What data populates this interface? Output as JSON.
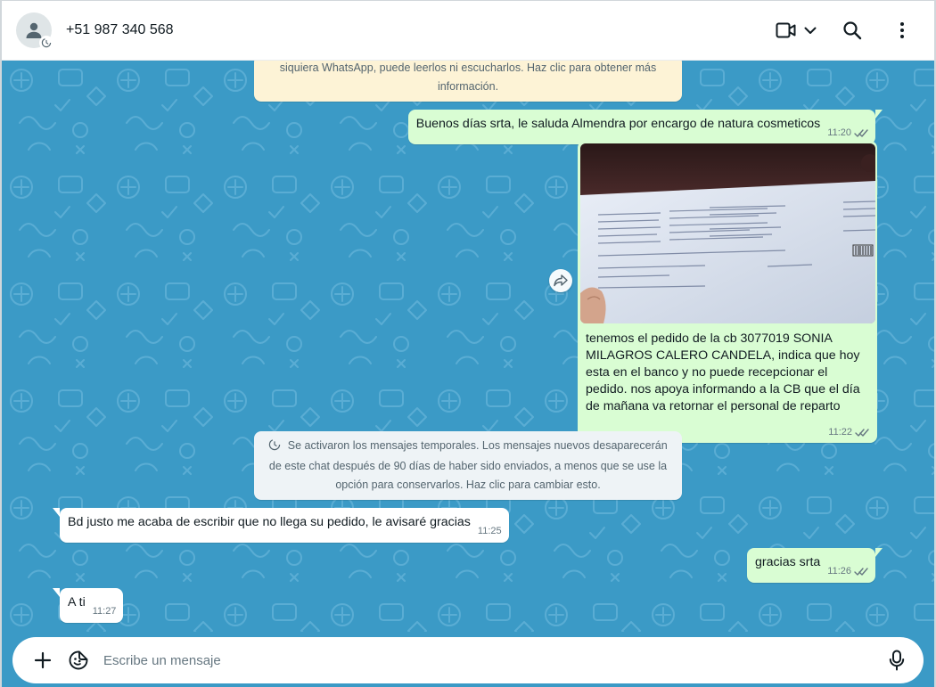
{
  "header": {
    "contact_name": "+51 987 340 568"
  },
  "banners": {
    "encryption_notice": "siquiera WhatsApp, puede leerlos ni escucharlos. Haz clic para obtener más información.",
    "disappearing_notice": "Se activaron los mensajes temporales. Los mensajes nuevos desaparecerán de este chat después de 90 días de haber sido enviados, a menos que se use la opción para conservarlos. Haz clic para cambiar esto."
  },
  "messages": [
    {
      "dir": "out",
      "text": "Buenos días srta, le saluda Almendra por encargo de natura cosmeticos",
      "time": "11:20",
      "ticks": "read"
    },
    {
      "dir": "out",
      "type": "image",
      "caption": "tenemos el pedido de la cb 3077019 SONIA MILAGROS CALERO CANDELA, indica que hoy esta en el banco y no puede recepcionar el pedido. nos apoya informando a la CB que el día de mañana va retornar el personal de reparto",
      "time": "11:22",
      "ticks": "read"
    },
    {
      "dir": "in",
      "text": "Bd justo me acaba de escribir que no llega su pedido, le avisaré gracias",
      "time": "11:25"
    },
    {
      "dir": "out",
      "text": "gracias srta",
      "time": "11:26",
      "ticks": "read"
    },
    {
      "dir": "in",
      "text": "A ti",
      "time": "11:27"
    }
  ],
  "composer": {
    "placeholder": "Escribe un mensaje"
  },
  "icons": {
    "avatar": "person-icon",
    "video": "video-camera-icon",
    "search": "search-icon",
    "menu": "more-vertical-icon",
    "attach": "plus-icon",
    "sticker": "sticker-icon",
    "mic": "microphone-icon",
    "forward": "forward-icon",
    "read_receipt": "double-check-icon"
  },
  "colors": {
    "chat_background": "#3b9ac6",
    "outgoing_bubble": "#d9fdd3",
    "incoming_bubble": "#ffffff",
    "warning_banner": "#fdf3d6",
    "info_banner": "#eef3f6",
    "tick_color": "#667781"
  }
}
